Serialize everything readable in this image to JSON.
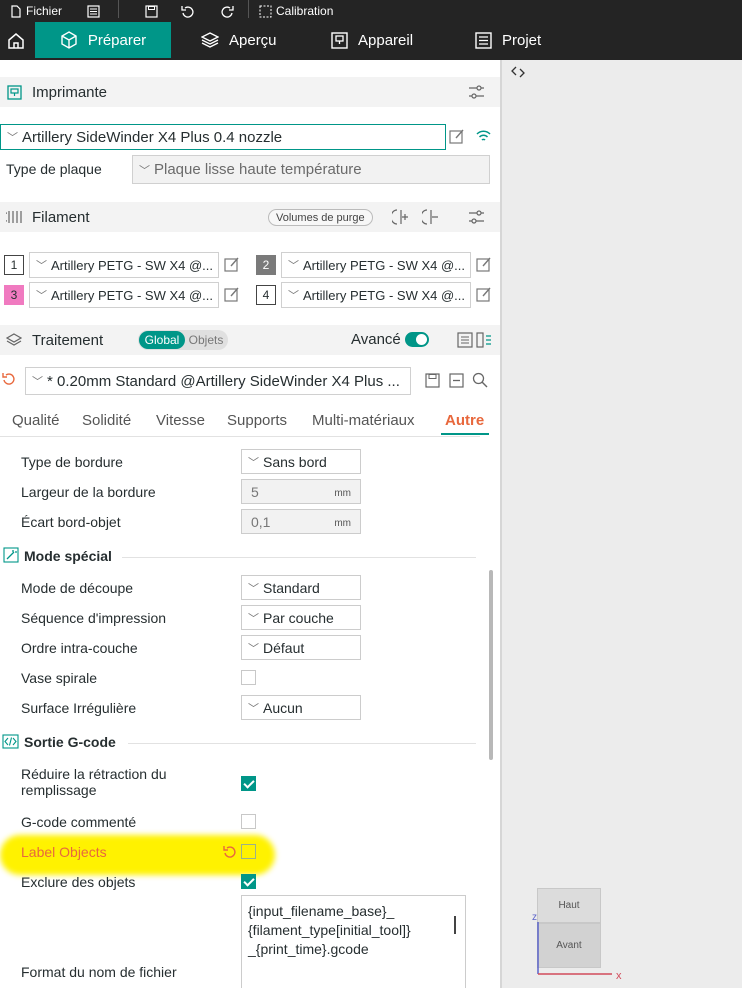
{
  "menubar": {
    "file_label": "Fichier",
    "calibration_label": "Calibration"
  },
  "tabs": [
    {
      "label": "Préparer"
    },
    {
      "label": "Aperçu"
    },
    {
      "label": "Appareil"
    },
    {
      "label": "Projet"
    }
  ],
  "printer": {
    "section_title": "Imprimante",
    "name": "Artillery SideWinder X4 Plus 0.4 nozzle",
    "plate_label": "Type de plaque",
    "plate_value": "Plaque lisse haute température"
  },
  "filament": {
    "section_title": "Filament",
    "purge_label": "Volumes de purge",
    "slots": [
      {
        "num": "1",
        "name": "Artillery PETG - SW X4 @...",
        "color": "#ffffff"
      },
      {
        "num": "2",
        "name": "Artillery PETG - SW X4 @...",
        "color": "#7a7a7a"
      },
      {
        "num": "3",
        "name": "Artillery PETG - SW X4 @...",
        "color": "#f07ac0"
      },
      {
        "num": "4",
        "name": "Artillery PETG - SW X4 @...",
        "color": "#ffffff"
      }
    ]
  },
  "process": {
    "section_title": "Traitement",
    "toggle_global": "Global",
    "toggle_objects": "Objets",
    "advanced_label": "Avancé",
    "preset": "* 0.20mm Standard @Artillery SideWinder X4 Plus ..."
  },
  "subtabs": [
    "Qualité",
    "Solidité",
    "Vitesse",
    "Supports",
    "Multi-matériaux",
    "Autre"
  ],
  "settings": {
    "border_type_label": "Type de bordure",
    "border_type_value": "Sans bord",
    "border_width_label": "Largeur de la bordure",
    "border_width_value": "5",
    "border_width_unit": "mm",
    "border_gap_label": "Écart bord-objet",
    "border_gap_value": "0,1",
    "border_gap_unit": "mm",
    "special_mode_title": "Mode spécial",
    "slicing_mode_label": "Mode de découpe",
    "slicing_mode_value": "Standard",
    "print_seq_label": "Séquence d'impression",
    "print_seq_value": "Par couche",
    "intra_layer_label": "Ordre intra-couche",
    "intra_layer_value": "Défaut",
    "spiral_vase_label": "Vase spirale",
    "fuzzy_label": "Surface Irrégulière",
    "fuzzy_value": "Aucun",
    "gcode_title": "Sortie G-code",
    "reduce_retract_label_1": "Réduire la rétraction du",
    "reduce_retract_label_2": "remplissage",
    "commented_label": "G-code commenté",
    "label_objects_label": "Label Objects",
    "exclude_label": "Exclure des objets",
    "filename_label": "Format du nom de fichier",
    "filename_line1": "{input_filename_base}_",
    "filename_line2": "{filament_type[initial_tool]}",
    "filename_line3": "_{print_time}.gcode"
  },
  "viewcube": {
    "top": "Haut",
    "front": "Avant",
    "axis_x": "x",
    "axis_z": "z"
  }
}
